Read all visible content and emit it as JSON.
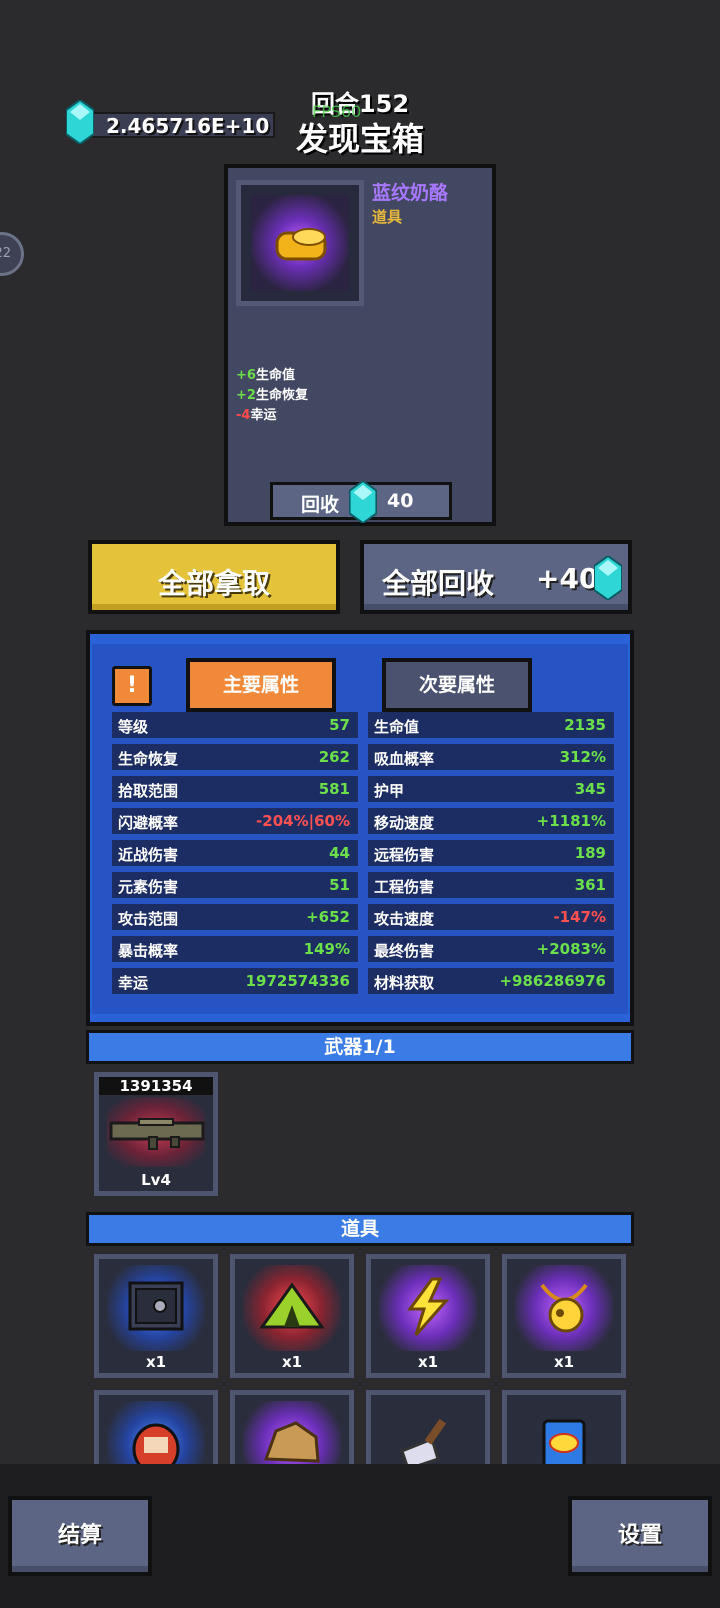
{
  "header": {
    "currency_value": "2.465716E+10",
    "round_label": "回合152",
    "fps_label": "FPS60",
    "title": "发现宝箱",
    "side_badge": "22"
  },
  "item_card": {
    "name": "蓝纹奶酪",
    "type": "道具",
    "stats": [
      {
        "value": "+6",
        "label": "生命值",
        "sign": "pos"
      },
      {
        "value": "+2",
        "label": "生命恢复",
        "sign": "pos"
      },
      {
        "value": "-4",
        "label": "幸运",
        "sign": "neg"
      }
    ],
    "recycle_label": "回收",
    "recycle_amount": "40"
  },
  "actions": {
    "take_all": "全部拿取",
    "recycle_all": "全部回收",
    "recycle_all_amount": "+40"
  },
  "stats_panel": {
    "warn": "!",
    "tab_primary": "主要属性",
    "tab_secondary": "次要属性",
    "left": [
      {
        "k": "等级",
        "v": "57",
        "c": "green"
      },
      {
        "k": "生命恢复",
        "v": "262",
        "c": "green"
      },
      {
        "k": "拾取范围",
        "v": "581",
        "c": "green"
      },
      {
        "k": "闪避概率",
        "v": "-204%|60%",
        "c": "red"
      },
      {
        "k": "近战伤害",
        "v": "44",
        "c": "green"
      },
      {
        "k": "元素伤害",
        "v": "51",
        "c": "green"
      },
      {
        "k": "攻击范围",
        "v": "+652",
        "c": "green"
      },
      {
        "k": "暴击概率",
        "v": "149%",
        "c": "green"
      },
      {
        "k": "幸运",
        "v": "1972574336",
        "c": "green"
      }
    ],
    "right": [
      {
        "k": "生命值",
        "v": "2135",
        "c": "green"
      },
      {
        "k": "吸血概率",
        "v": "312%",
        "c": "green"
      },
      {
        "k": "护甲",
        "v": "345",
        "c": "green"
      },
      {
        "k": "移动速度",
        "v": "+1181%",
        "c": "green"
      },
      {
        "k": "远程伤害",
        "v": "189",
        "c": "green"
      },
      {
        "k": "工程伤害",
        "v": "361",
        "c": "green"
      },
      {
        "k": "攻击速度",
        "v": "-147%",
        "c": "red"
      },
      {
        "k": "最终伤害",
        "v": "+2083%",
        "c": "green"
      },
      {
        "k": "材料获取",
        "v": "+986286976",
        "c": "green"
      }
    ]
  },
  "weapons": {
    "header": "武器1/1",
    "slot": {
      "power": "1391354",
      "level": "Lv4"
    }
  },
  "props": {
    "header": "道具",
    "row1": [
      {
        "icon": "safe-icon",
        "qty": "x1",
        "glow": "blue"
      },
      {
        "icon": "tent-icon",
        "qty": "x1",
        "glow": "red"
      },
      {
        "icon": "lightning-icon",
        "qty": "x1",
        "glow": "purple"
      },
      {
        "icon": "coin-necklace-icon",
        "qty": "x1",
        "glow": "purple"
      }
    ],
    "row2": [
      {
        "icon": "daruma-icon",
        "glow": "blue"
      },
      {
        "icon": "ore-icon",
        "glow": "purple"
      },
      {
        "icon": "cleaver-icon",
        "glow": "none"
      },
      {
        "icon": "chips-bag-icon",
        "glow": "none"
      }
    ]
  },
  "bottom": {
    "settle": "结算",
    "settings": "设置"
  }
}
